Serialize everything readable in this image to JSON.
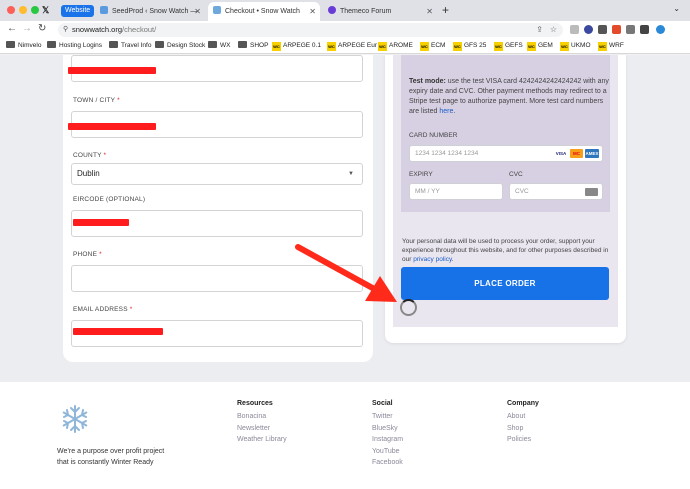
{
  "browser": {
    "tab_group_label": "Website",
    "tabs": [
      {
        "title": "SeedProd ‹ Snow Watch —",
        "active": false
      },
      {
        "title": "Checkout • Snow Watch",
        "active": true
      },
      {
        "title": "Themeco Forum",
        "active": false
      }
    ],
    "url_domain": "snowwatch.org",
    "url_path": "/checkout/",
    "bookmarks": [
      {
        "label": "Nimvelo",
        "kind": "folder"
      },
      {
        "label": "Hosting Logins",
        "kind": "folder"
      },
      {
        "label": "Travel Info",
        "kind": "folder"
      },
      {
        "label": "Design Stock",
        "kind": "folder"
      },
      {
        "label": "WX",
        "kind": "folder"
      },
      {
        "label": "SHOP",
        "kind": "folder"
      },
      {
        "label": "ARPEGE 0.1",
        "kind": "wc"
      },
      {
        "label": "ARPEGE Eur",
        "kind": "wc"
      },
      {
        "label": "AROME",
        "kind": "wc"
      },
      {
        "label": "ECM",
        "kind": "wc"
      },
      {
        "label": "GFS 25",
        "kind": "wc"
      },
      {
        "label": "GEFS",
        "kind": "wc"
      },
      {
        "label": "GEM",
        "kind": "wc"
      },
      {
        "label": "UKMO",
        "kind": "wc"
      },
      {
        "label": "WRF",
        "kind": "wc"
      }
    ]
  },
  "form": {
    "town_label": "TOWN / CITY",
    "county_label": "COUNTY",
    "county_value": "Dublin",
    "eircode_label": "EIRCODE (OPTIONAL)",
    "phone_label": "PHONE",
    "email_label": "EMAIL ADDRESS",
    "required_mark": "*"
  },
  "payment": {
    "test_mode_title": "Test mode:",
    "test_mode_text": " use the test VISA card 4242424242424242 with any expiry date and CVC. Other payment methods may redirect to a Stripe test page to authorize payment. More test card numbers are listed ",
    "test_mode_link": "here",
    "card_number_label": "CARD NUMBER",
    "card_number_placeholder": "1234 1234 1234 1234",
    "card_logos": [
      "VISA",
      "MC",
      "AMEX"
    ],
    "expiry_label": "EXPIRY",
    "expiry_placeholder": "MM / YY",
    "cvc_label": "CVC",
    "cvc_placeholder": "CVC",
    "privacy_text": "Your personal data will be used to process your order, support your experience throughout this website, and for other purposes described in our ",
    "privacy_link": "privacy policy",
    "place_order_label": "PLACE ORDER"
  },
  "footer": {
    "tagline_line1": "We’re a purpose over profit project",
    "tagline_line2": "that is constantly Winter Ready",
    "columns": [
      {
        "heading": "Resources",
        "links": [
          "Bonacina",
          "Newsletter",
          "Weather Library"
        ]
      },
      {
        "heading": "Social",
        "links": [
          "Twitter",
          "BlueSky",
          "Instagram",
          "YouTube",
          "Facebook"
        ]
      },
      {
        "heading": "Company",
        "links": [
          "About",
          "Shop",
          "Policies"
        ]
      }
    ]
  },
  "colors": {
    "accent": "#1772e8",
    "redaction": "#ff1c1c",
    "arrow": "#ff2a1a",
    "payment_panel": "#d7d0e2"
  }
}
